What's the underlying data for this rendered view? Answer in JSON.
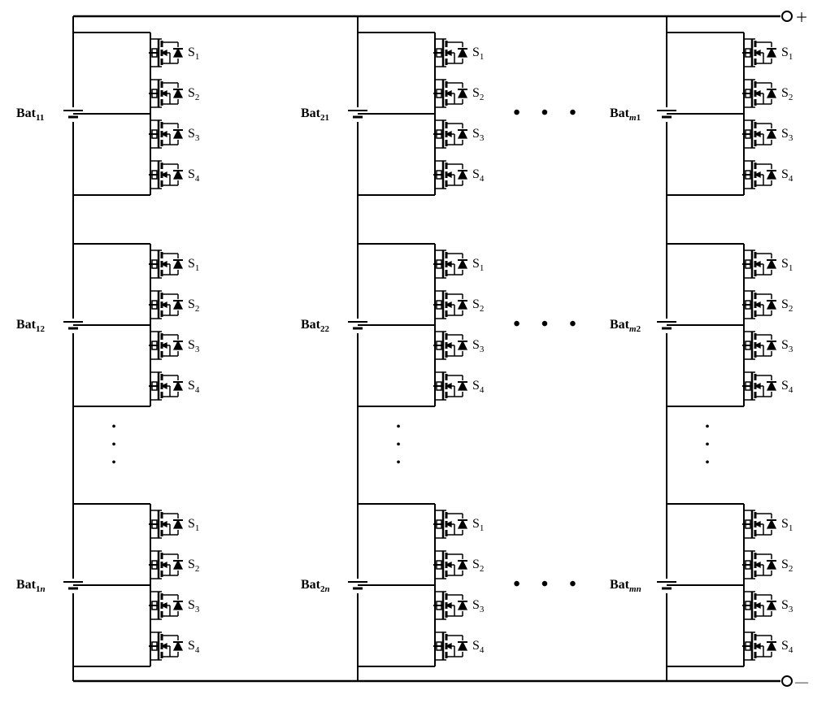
{
  "terminals": {
    "plus": "＋",
    "minus": "—"
  },
  "switch_labels": [
    "S",
    "S",
    "S",
    "S"
  ],
  "switch_subs": [
    "1",
    "2",
    "3",
    "4"
  ],
  "bat_prefix": "Bat",
  "columns": [
    {
      "subs": [
        "11",
        "12",
        "1"
      ],
      "rows_last_italic_n": true
    },
    {
      "subs": [
        "21",
        "22",
        "2"
      ],
      "rows_last_italic_n": true
    },
    {
      "subs": [
        null,
        null,
        null
      ],
      "m_rows": [
        "1",
        "2",
        null
      ],
      "rows_last_italic_n": true,
      "uses_m": true
    }
  ],
  "ellipsis_h": "•  •  •",
  "ellipsis_v": "•"
}
